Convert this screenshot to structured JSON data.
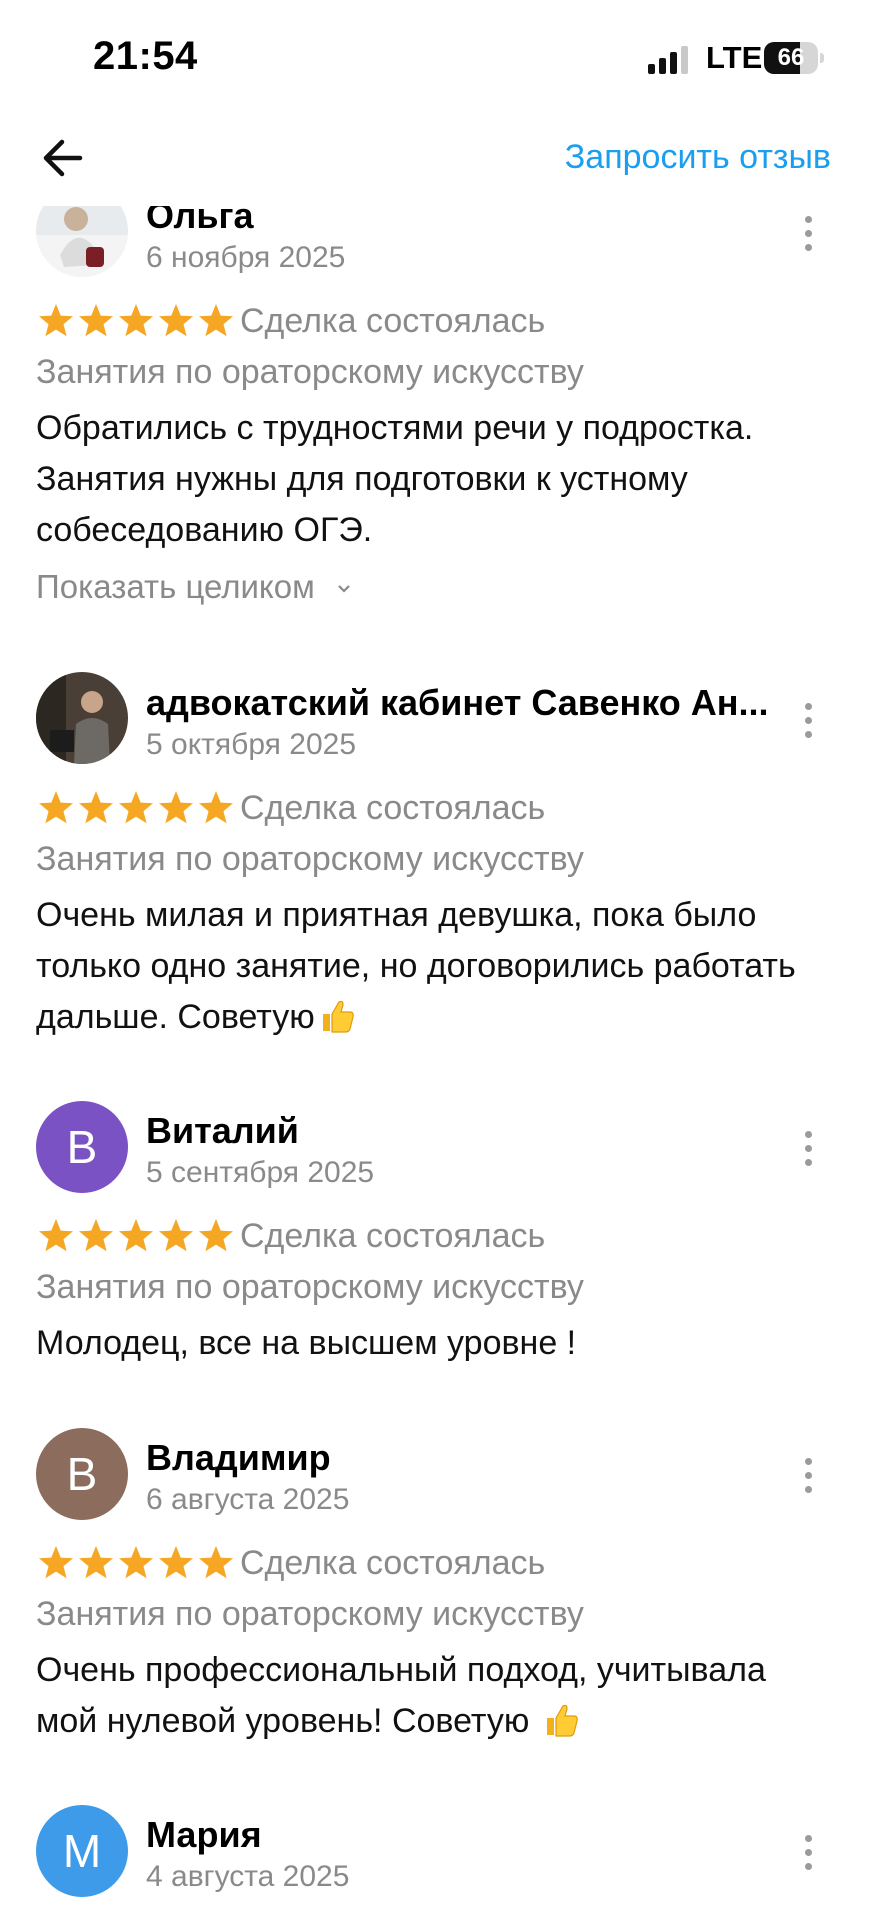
{
  "status": {
    "time": "21:54",
    "network": "LTE",
    "battery": "66",
    "battery_level": 0.66
  },
  "header": {
    "request_label": "Запросить отзыв",
    "back_icon": "arrow-left-icon"
  },
  "colors": {
    "accent": "#1a9ef0",
    "star": "#f5a623",
    "muted": "#8a8a8a"
  },
  "reviews": [
    {
      "name": "Ольга",
      "date": "6 ноября 2025",
      "rating": 5,
      "deal": "Сделка состоялась",
      "service": "Занятия по ораторскому искусству",
      "lines": [
        "Обратились с трудностями речи у подростка.",
        "Занятия нужны для подготовки к устному",
        "собеседованию  ОГЭ."
      ],
      "show_full": "Показать целиком",
      "avatar_type": "photo"
    },
    {
      "name": "адвокатский кабинет Савенко Ан...",
      "date": "5 октября 2025",
      "rating": 5,
      "deal": "Сделка состоялась",
      "service": "Занятия по ораторскому искусству",
      "lines": [
        "Очень милая и приятная девушка, пока было",
        "только одно занятие, но договорились работать",
        "дальше. Советую"
      ],
      "avatar_type": "photo"
    },
    {
      "name": "Виталий",
      "date": "5 сентября 2025",
      "rating": 5,
      "deal": "Сделка состоялась",
      "service": "Занятия по ораторскому искусству",
      "lines": [
        "Молодец, все на высшем уровне !"
      ],
      "avatar_letter": "В",
      "avatar_color": "#7b52c4"
    },
    {
      "name": "Владимир",
      "date": "6 августа 2025",
      "rating": 5,
      "deal": "Сделка состоялась",
      "service": "Занятия по ораторскому искусству",
      "lines": [
        "Очень профессиональный подход, учитывала",
        "мой нулевой уровень! Советую "
      ],
      "avatar_letter": "В",
      "avatar_color": "#8c6c5c"
    },
    {
      "name": "Мария",
      "date": "4 августа 2025",
      "avatar_letter": "М",
      "avatar_color": "#3d9be9"
    }
  ]
}
